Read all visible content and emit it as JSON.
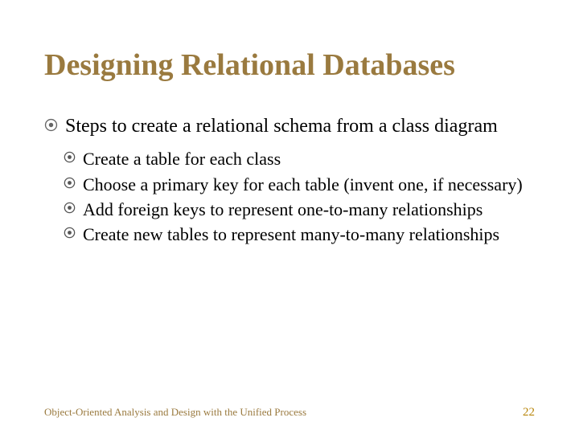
{
  "title": "Designing Relational Databases",
  "bullets_lvl1": [
    {
      "text": "Steps to create a relational schema from a class diagram"
    }
  ],
  "bullets_lvl2": [
    {
      "text": "Create a table for each class"
    },
    {
      "text": "Choose a primary key for each table (invent one, if necessary)"
    },
    {
      "text": "Add foreign keys to represent one-to-many relationships"
    },
    {
      "text": "Create new tables to represent many-to-many relationships"
    }
  ],
  "footer": {
    "text": "Object-Oriented Analysis and Design with the Unified Process",
    "page": "22"
  }
}
